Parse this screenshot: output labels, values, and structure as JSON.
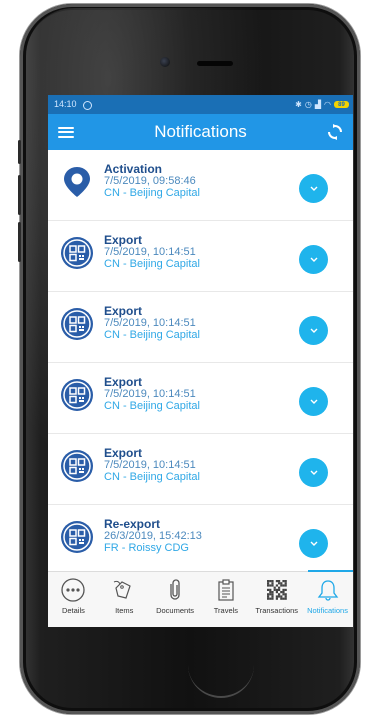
{
  "statusbar": {
    "time": "14:10",
    "battery": "89"
  },
  "appbar": {
    "title": "Notifications"
  },
  "notifications": [
    {
      "type": "Activation",
      "icon": "location-pin-icon",
      "date": "7/5/2019, 09:58:46",
      "place": "CN - Beijing Capital"
    },
    {
      "type": "Export",
      "icon": "qr-code-icon",
      "date": "7/5/2019, 10:14:51",
      "place": "CN - Beijing Capital"
    },
    {
      "type": "Export",
      "icon": "qr-code-icon",
      "date": "7/5/2019, 10:14:51",
      "place": "CN - Beijing Capital"
    },
    {
      "type": "Export",
      "icon": "qr-code-icon",
      "date": "7/5/2019, 10:14:51",
      "place": "CN - Beijing Capital"
    },
    {
      "type": "Export",
      "icon": "qr-code-icon",
      "date": "7/5/2019, 10:14:51",
      "place": "CN - Beijing Capital"
    },
    {
      "type": "Re-export",
      "icon": "qr-code-icon",
      "date": "26/3/2019, 15:42:13",
      "place": "FR - Roissy CDG"
    }
  ],
  "tabs": [
    {
      "label": "Details",
      "icon": "more-dots-icon"
    },
    {
      "label": "Items",
      "icon": "tag-icon"
    },
    {
      "label": "Documents",
      "icon": "paperclip-icon"
    },
    {
      "label": "Travels",
      "icon": "clipboard-icon"
    },
    {
      "label": "Transactions",
      "icon": "qr-code-icon"
    },
    {
      "label": "Notifications",
      "icon": "bell-icon",
      "active": true
    }
  ],
  "colors": {
    "primary": "#2196e6",
    "statusbar": "#1a6fb5",
    "accent": "#1fb4ec",
    "title": "#1f4e8c"
  }
}
